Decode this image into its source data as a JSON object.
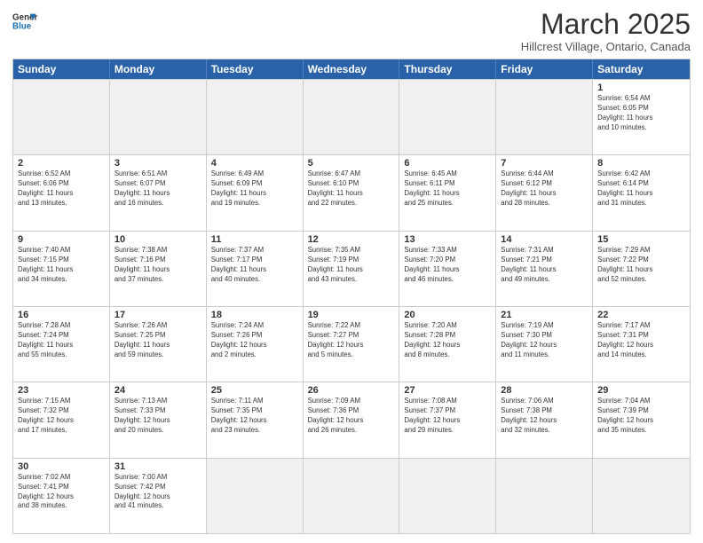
{
  "header": {
    "logo_line1": "General",
    "logo_line2": "Blue",
    "month": "March 2025",
    "location": "Hillcrest Village, Ontario, Canada"
  },
  "weekdays": [
    "Sunday",
    "Monday",
    "Tuesday",
    "Wednesday",
    "Thursday",
    "Friday",
    "Saturday"
  ],
  "rows": [
    [
      {
        "day": "",
        "info": ""
      },
      {
        "day": "",
        "info": ""
      },
      {
        "day": "",
        "info": ""
      },
      {
        "day": "",
        "info": ""
      },
      {
        "day": "",
        "info": ""
      },
      {
        "day": "",
        "info": ""
      },
      {
        "day": "1",
        "info": "Sunrise: 6:54 AM\nSunset: 6:05 PM\nDaylight: 11 hours\nand 10 minutes."
      }
    ],
    [
      {
        "day": "2",
        "info": "Sunrise: 6:52 AM\nSunset: 6:06 PM\nDaylight: 11 hours\nand 13 minutes."
      },
      {
        "day": "3",
        "info": "Sunrise: 6:51 AM\nSunset: 6:07 PM\nDaylight: 11 hours\nand 16 minutes."
      },
      {
        "day": "4",
        "info": "Sunrise: 6:49 AM\nSunset: 6:09 PM\nDaylight: 11 hours\nand 19 minutes."
      },
      {
        "day": "5",
        "info": "Sunrise: 6:47 AM\nSunset: 6:10 PM\nDaylight: 11 hours\nand 22 minutes."
      },
      {
        "day": "6",
        "info": "Sunrise: 6:45 AM\nSunset: 6:11 PM\nDaylight: 11 hours\nand 25 minutes."
      },
      {
        "day": "7",
        "info": "Sunrise: 6:44 AM\nSunset: 6:12 PM\nDaylight: 11 hours\nand 28 minutes."
      },
      {
        "day": "8",
        "info": "Sunrise: 6:42 AM\nSunset: 6:14 PM\nDaylight: 11 hours\nand 31 minutes."
      }
    ],
    [
      {
        "day": "9",
        "info": "Sunrise: 7:40 AM\nSunset: 7:15 PM\nDaylight: 11 hours\nand 34 minutes."
      },
      {
        "day": "10",
        "info": "Sunrise: 7:38 AM\nSunset: 7:16 PM\nDaylight: 11 hours\nand 37 minutes."
      },
      {
        "day": "11",
        "info": "Sunrise: 7:37 AM\nSunset: 7:17 PM\nDaylight: 11 hours\nand 40 minutes."
      },
      {
        "day": "12",
        "info": "Sunrise: 7:35 AM\nSunset: 7:19 PM\nDaylight: 11 hours\nand 43 minutes."
      },
      {
        "day": "13",
        "info": "Sunrise: 7:33 AM\nSunset: 7:20 PM\nDaylight: 11 hours\nand 46 minutes."
      },
      {
        "day": "14",
        "info": "Sunrise: 7:31 AM\nSunset: 7:21 PM\nDaylight: 11 hours\nand 49 minutes."
      },
      {
        "day": "15",
        "info": "Sunrise: 7:29 AM\nSunset: 7:22 PM\nDaylight: 11 hours\nand 52 minutes."
      }
    ],
    [
      {
        "day": "16",
        "info": "Sunrise: 7:28 AM\nSunset: 7:24 PM\nDaylight: 11 hours\nand 55 minutes."
      },
      {
        "day": "17",
        "info": "Sunrise: 7:26 AM\nSunset: 7:25 PM\nDaylight: 11 hours\nand 59 minutes."
      },
      {
        "day": "18",
        "info": "Sunrise: 7:24 AM\nSunset: 7:26 PM\nDaylight: 12 hours\nand 2 minutes."
      },
      {
        "day": "19",
        "info": "Sunrise: 7:22 AM\nSunset: 7:27 PM\nDaylight: 12 hours\nand 5 minutes."
      },
      {
        "day": "20",
        "info": "Sunrise: 7:20 AM\nSunset: 7:28 PM\nDaylight: 12 hours\nand 8 minutes."
      },
      {
        "day": "21",
        "info": "Sunrise: 7:19 AM\nSunset: 7:30 PM\nDaylight: 12 hours\nand 11 minutes."
      },
      {
        "day": "22",
        "info": "Sunrise: 7:17 AM\nSunset: 7:31 PM\nDaylight: 12 hours\nand 14 minutes."
      }
    ],
    [
      {
        "day": "23",
        "info": "Sunrise: 7:15 AM\nSunset: 7:32 PM\nDaylight: 12 hours\nand 17 minutes."
      },
      {
        "day": "24",
        "info": "Sunrise: 7:13 AM\nSunset: 7:33 PM\nDaylight: 12 hours\nand 20 minutes."
      },
      {
        "day": "25",
        "info": "Sunrise: 7:11 AM\nSunset: 7:35 PM\nDaylight: 12 hours\nand 23 minutes."
      },
      {
        "day": "26",
        "info": "Sunrise: 7:09 AM\nSunset: 7:36 PM\nDaylight: 12 hours\nand 26 minutes."
      },
      {
        "day": "27",
        "info": "Sunrise: 7:08 AM\nSunset: 7:37 PM\nDaylight: 12 hours\nand 29 minutes."
      },
      {
        "day": "28",
        "info": "Sunrise: 7:06 AM\nSunset: 7:38 PM\nDaylight: 12 hours\nand 32 minutes."
      },
      {
        "day": "29",
        "info": "Sunrise: 7:04 AM\nSunset: 7:39 PM\nDaylight: 12 hours\nand 35 minutes."
      }
    ],
    [
      {
        "day": "30",
        "info": "Sunrise: 7:02 AM\nSunset: 7:41 PM\nDaylight: 12 hours\nand 38 minutes."
      },
      {
        "day": "31",
        "info": "Sunrise: 7:00 AM\nSunset: 7:42 PM\nDaylight: 12 hours\nand 41 minutes."
      },
      {
        "day": "",
        "info": ""
      },
      {
        "day": "",
        "info": ""
      },
      {
        "day": "",
        "info": ""
      },
      {
        "day": "",
        "info": ""
      },
      {
        "day": "",
        "info": ""
      }
    ]
  ]
}
